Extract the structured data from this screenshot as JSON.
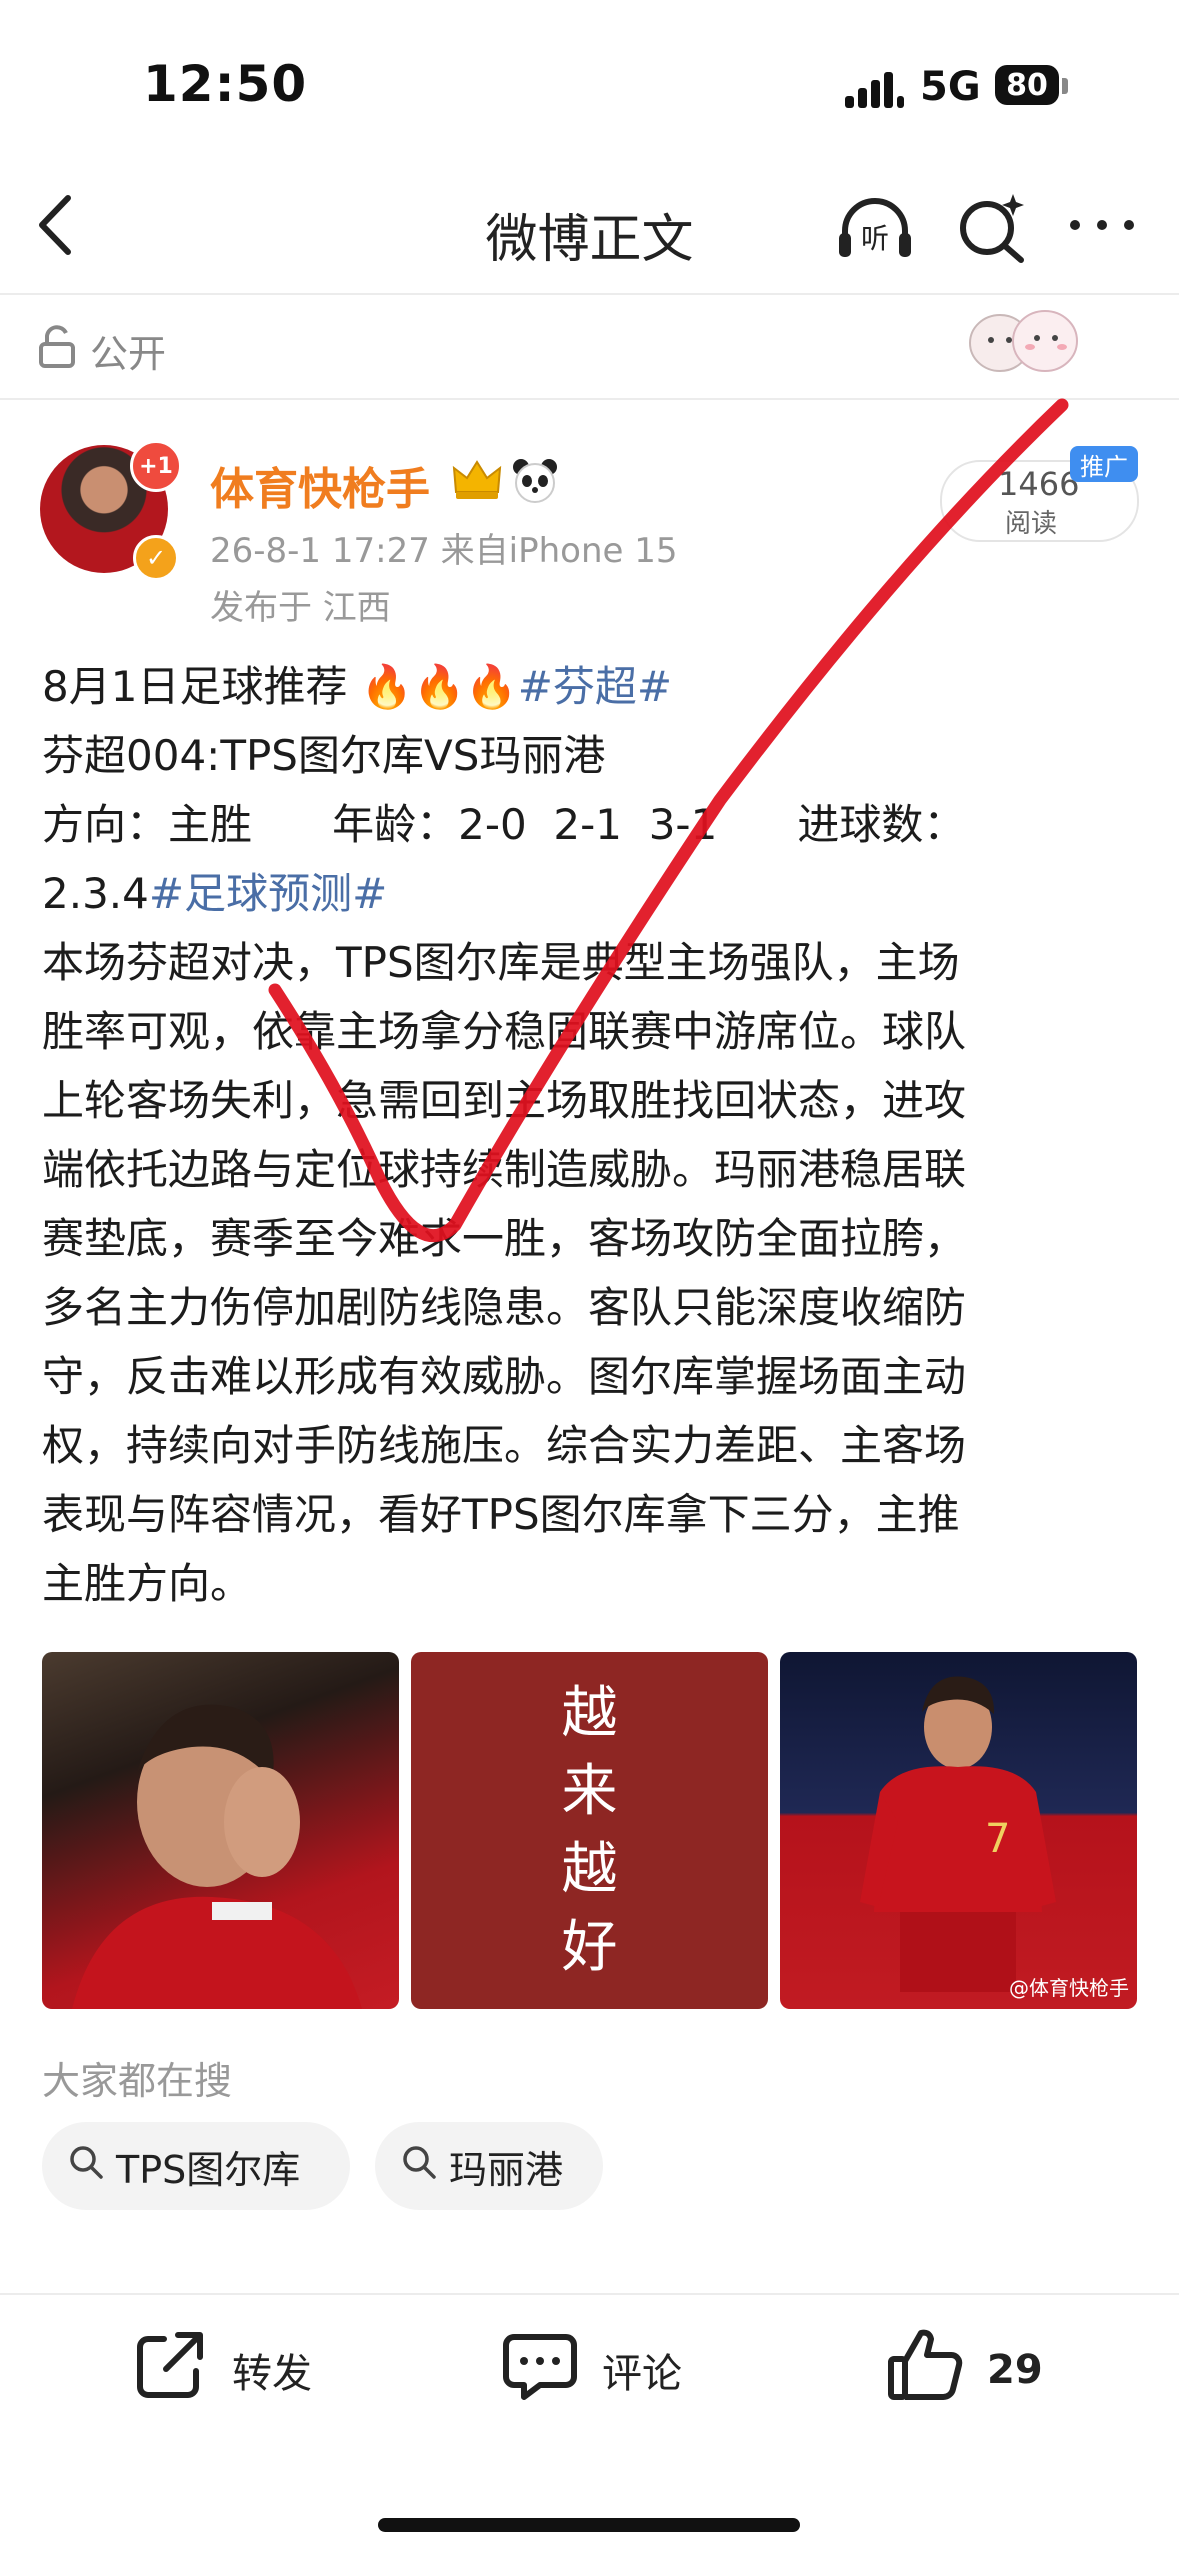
{
  "status_bar": {
    "time": "12:50",
    "network": "5G",
    "battery": "80"
  },
  "nav": {
    "title": "微博正文",
    "listen_label": "听"
  },
  "visibility": {
    "label": "公开"
  },
  "author": {
    "name": "体育快枪手",
    "avatar_badge": "+1",
    "meta": "26-8-1 17:27  来自iPhone 15",
    "location": "发布于 江西"
  },
  "stats": {
    "reads": "1466",
    "reads_label": "阅读",
    "promo_tag": "推广"
  },
  "post": {
    "line1_text": "8月1日足球推荐",
    "line1_tag": "#芬超#",
    "line2": "芬超004:TPS图尔库VS玛丽港",
    "line3": "方向：主胜      年龄：2-0  2-1  3-1      进球数：",
    "line4_text": "2.3.4",
    "line4_tag": "#足球预测#",
    "body_lines": [
      "本场芬超对决，TPS图尔库是典型主场强队，主场",
      "胜率可观，依靠主场拿分稳固联赛中游席位。球队",
      "上轮客场失利，急需回到主场取胜找回状态，进攻",
      "端依托边路与定位球持续制造威胁。玛丽港稳居联",
      "赛垫底，赛季至今难求一胜，客场攻防全面拉胯，",
      "多名主力伤停加剧防线隐患。客队只能深度收缩防",
      "守，反击难以形成有效威胁。图尔库掌握场面主动",
      "权，持续向对手防线施压。综合实力差距、主客场",
      "表现与阵容情况，看好TPS图尔库拿下三分，主推",
      "主胜方向。"
    ]
  },
  "images": {
    "middle_text": [
      "越",
      "来",
      "越",
      "好"
    ],
    "watermark": "@体育快枪手"
  },
  "searches": {
    "title": "大家都在搜",
    "chips": [
      "TPS图尔库",
      "玛丽港"
    ]
  },
  "actions": {
    "repost": "转发",
    "comment": "评论",
    "like_count": "29"
  },
  "colors": {
    "username": "#f07d1f",
    "hashtag": "#4a6ea6",
    "check_mark": "#e0101e",
    "promo": "#3f8ef0"
  }
}
